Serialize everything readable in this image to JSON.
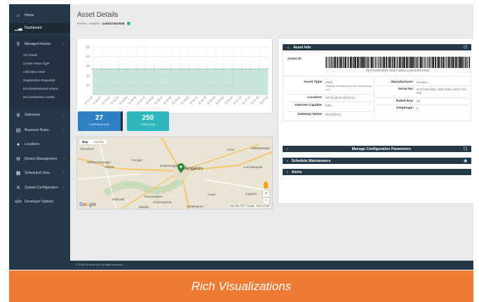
{
  "sidebar": {
    "items": [
      {
        "label": "Home",
        "icon": "home-icon"
      },
      {
        "label": "Dashboard",
        "icon": "chart-icon"
      },
      {
        "label": "Managed Assets",
        "icon": "assets-icon"
      },
      {
        "label": "Gateways",
        "icon": "gateway-icon"
      },
      {
        "label": "Business Rules",
        "icon": "rules-icon"
      },
      {
        "label": "Locations",
        "icon": "location-icon"
      },
      {
        "label": "Device Management",
        "icon": "gear-icon"
      },
      {
        "label": "Scheduled Jobs",
        "icon": "calendar-icon"
      },
      {
        "label": "System Configuration",
        "icon": "tools-icon"
      },
      {
        "label": "Developer Options",
        "icon": "code-icon"
      }
    ],
    "sub_items": [
      "All Assets",
      "Create Asset Type",
      "Add New Asset",
      "Registration Requests",
      "Decommissioned Assets",
      "Decommission Assets"
    ]
  },
  "header": {
    "title": "Asset Details",
    "breadcrumb": [
      "Home",
      "Assets",
      "1c6e374e1948"
    ]
  },
  "chart_data": {
    "type": "area",
    "x": [
      "15:34:16",
      "15:34:27",
      "15:34:36",
      "15:34:46",
      "15:34:56",
      "15:35:06",
      "15:35:16",
      "15:35:26",
      "15:35:36",
      "15:35:46",
      "15:35:56",
      "15:36:06",
      "15:36:16",
      "15:36:26",
      "15:36:36",
      "15:36:46",
      "15:36:56",
      "15:37:06",
      "15:37:16",
      "15:37:26",
      "15:37:36"
    ],
    "values": [
      27,
      27,
      27,
      27,
      27,
      27,
      27,
      27,
      27,
      27,
      27,
      27,
      27,
      27,
      27,
      27,
      27,
      27,
      27,
      27,
      27
    ],
    "yticks": [
      10,
      20,
      30,
      40,
      50
    ],
    "ylim": [
      0,
      53
    ],
    "color": "#9fcfc0"
  },
  "tiles": {
    "temperature": {
      "value": "27",
      "label": "TEMPERATURE"
    },
    "vibration": {
      "value": "250",
      "label": "VIBRATION"
    }
  },
  "map": {
    "tabs": [
      "Map",
      "Satellite"
    ],
    "labels": [
      "Tirunelveli",
      "Kolar",
      "Mahbubnagar",
      "Adishunchanagiri",
      "Kunigal",
      "Yadiyur",
      "Nelamangala",
      "Bengaluru",
      "Kurmanapalli",
      "Ramanagara",
      "Hosur",
      "Kuppam",
      "Channapatna",
      "Kanakapura",
      "Maddur",
      "Malavalli"
    ],
    "attribution": "Map data ©2017 Google · Terms of Use",
    "logo": "Google"
  },
  "panel": {
    "asset_info_title": "Asset Info",
    "asset_id_label": "Asset Id:",
    "asset_id_value": "0e7fce99-b891-4b87-a55a-1c6e374e1948",
    "fields": {
      "asset_type_label": "Asset Type:",
      "asset_type_value": "HWC",
      "asset_type_desc": "Heating ventilating and air conditioning unit",
      "location_label": "Location:",
      "location_value": "MT-IN-BLR-MTW-P1",
      "internet_label": "Internet Capable:",
      "internet_value": "false",
      "gateway_label": "Gateway Name:",
      "gateway_value": "MTGW001",
      "manufacturer_label": "Manufacturer:",
      "manufacturer_value": "Nordea",
      "serial_label": "Serial No:",
      "serial_value": "0e7fce99-b891-4b87-a55a-1c6e374e1948",
      "rated_label": "Rated Kva:",
      "rated_value": "25",
      "amperage_label": "Amperage:",
      "amperage_value": "5"
    },
    "manage_title": "Manage Configuration Parameters",
    "schedule_title": "Schedule Maintanance",
    "alerts_title": "Alerts"
  },
  "footer": {
    "text": "© 2016 Mindtree Ltd. All rights reserved."
  },
  "banner": {
    "text": "Rich Visualizations"
  },
  "colors": {
    "sidebar": "#263746",
    "accent_orange": "#ef7b35",
    "tile_blue": "#2f80c5",
    "tile_teal": "#2fb8bc",
    "ok_green": "#2bb673"
  }
}
